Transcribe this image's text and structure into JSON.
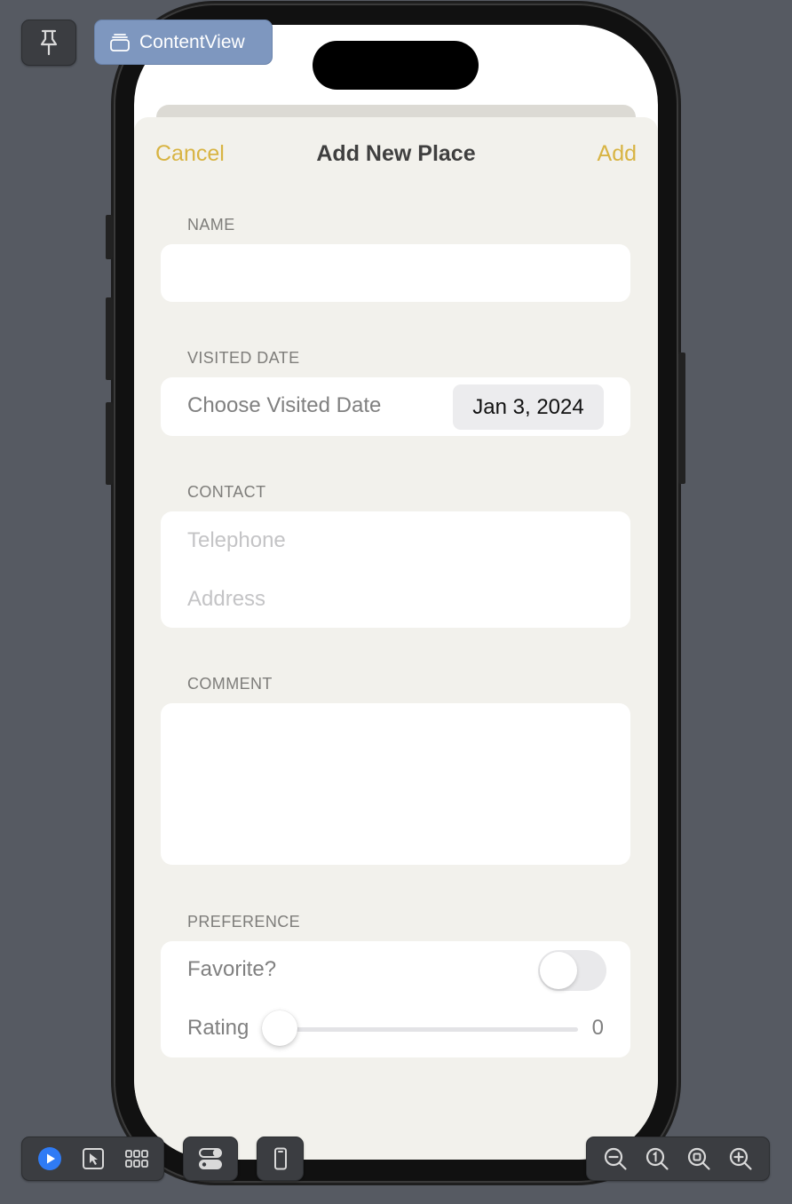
{
  "preview_toolbar": {
    "view_name": "ContentView"
  },
  "nav": {
    "cancel_label": "Cancel",
    "title": "Add New Place",
    "add_label": "Add"
  },
  "sections": {
    "name": {
      "header": "NAME",
      "value": ""
    },
    "visited_date": {
      "header": "VISITED DATE",
      "label": "Choose Visited Date",
      "value": "Jan 3, 2024"
    },
    "contact": {
      "header": "CONTACT",
      "telephone_placeholder": "Telephone",
      "address_placeholder": "Address"
    },
    "comment": {
      "header": "COMMENT",
      "value": ""
    },
    "preference": {
      "header": "PREFERENCE",
      "favorite_label": "Favorite?",
      "favorite_on": false,
      "rating_label": "Rating",
      "rating_value": "0"
    }
  },
  "colors": {
    "accent": "#d8b443",
    "sheet_background": "#f2f1ec",
    "canvas_background": "#565a62",
    "chip_background": "#7e97bf",
    "play_blue": "#2f7bf5"
  },
  "icons": {
    "pin": "pin-icon",
    "view": "stacked-view-icon",
    "live": "play-icon",
    "select": "pointer-icon",
    "variants": "grid-icon",
    "settings": "toggles-icon",
    "device": "phone-icon",
    "zoom_out": "zoom-out-icon",
    "zoom_actual": "zoom-100-icon",
    "zoom_fit": "zoom-fit-icon",
    "zoom_in": "zoom-in-icon"
  }
}
